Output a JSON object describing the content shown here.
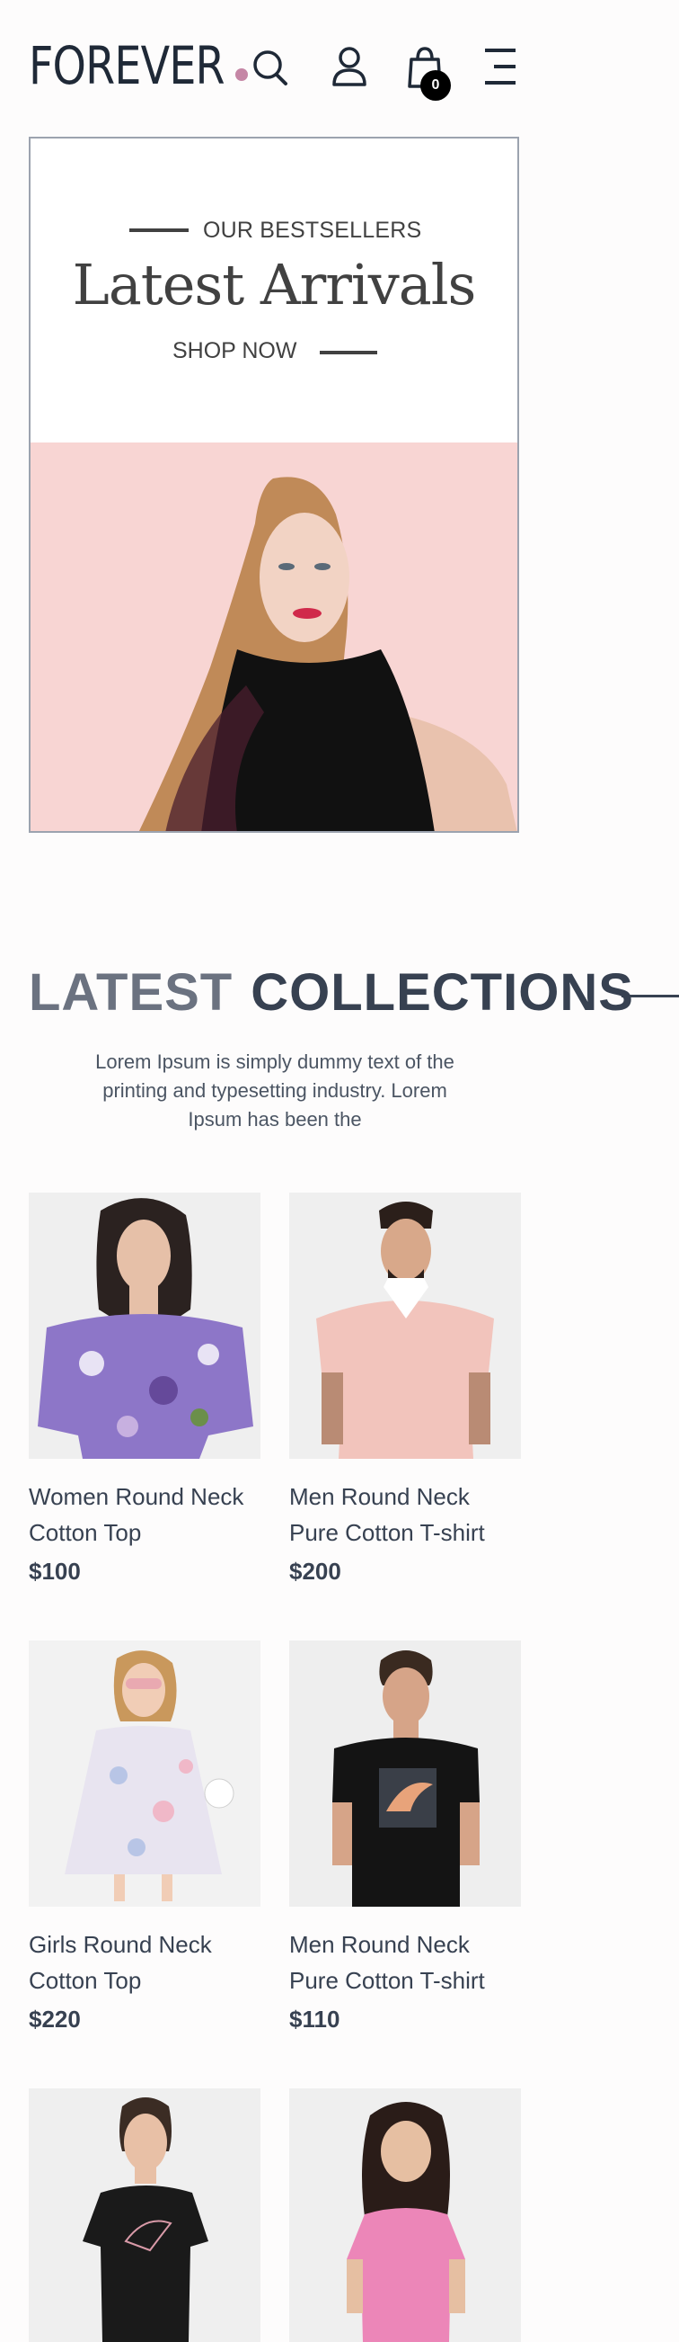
{
  "header": {
    "logo": "FOREVER",
    "icons": [
      "search-icon",
      "profile-icon",
      "cart-icon",
      "menu-icon"
    ],
    "cart_count": "0",
    "accent_color": "#c586a5"
  },
  "hero": {
    "eyebrow": "OUR BESTSELLERS",
    "title": "Latest Arrivals",
    "cta": "SHOP NOW",
    "image_bg": "#f8d5d3"
  },
  "collections": {
    "title_part1": "LATEST",
    "title_part2": "COLLECTIONS",
    "description": "Lorem Ipsum is simply dummy text of the printing and typesetting industry. Lorem Ipsum has been the"
  },
  "products": [
    {
      "name_line1": "Women Round Neck",
      "name_line2": "Cotton Top",
      "price": "$100"
    },
    {
      "name_line1": "Men Round Neck",
      "name_line2": "Pure Cotton T-shirt",
      "price": "$200"
    },
    {
      "name_line1": "Girls Round Neck",
      "name_line2": "Cotton Top",
      "price": "$220"
    },
    {
      "name_line1": "Men Round Neck",
      "name_line2": "Pure Cotton T-shirt",
      "price": "$110"
    },
    {
      "name_line1": "",
      "name_line2": "",
      "price": ""
    },
    {
      "name_line1": "",
      "name_line2": "",
      "price": ""
    }
  ]
}
